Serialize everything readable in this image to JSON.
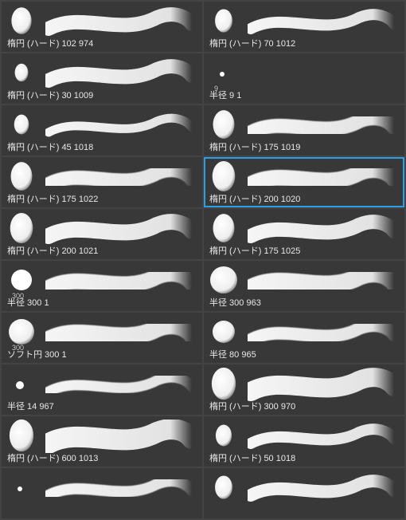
{
  "brushes": [
    {
      "label": "楕円 (ハード) 102 974",
      "tip": "ellipse-hard",
      "size": 30,
      "badge": "",
      "stroke": "s1",
      "selected": false
    },
    {
      "label": "楕円 (ハード) 70 1012",
      "tip": "ellipse-hard",
      "size": 26,
      "badge": "",
      "stroke": "s2",
      "selected": false
    },
    {
      "label": "楕円 (ハード) 30 1009",
      "tip": "ellipse-hard",
      "size": 20,
      "badge": "",
      "stroke": "s3",
      "selected": false
    },
    {
      "label": "半径  9 1",
      "tip": "radius-dot",
      "size": 6,
      "badge": "9",
      "stroke": "none",
      "selected": false
    },
    {
      "label": "楕円 (ハード) 45 1018",
      "tip": "ellipse-hard",
      "size": 22,
      "badge": "",
      "stroke": "s4",
      "selected": false
    },
    {
      "label": "楕円 (ハード) 175 1019",
      "tip": "ellipse-hard",
      "size": 32,
      "badge": "",
      "stroke": "s5",
      "selected": false
    },
    {
      "label": "楕円 (ハード) 175 1022",
      "tip": "ellipse-hard",
      "size": 32,
      "badge": "",
      "stroke": "s6",
      "selected": false
    },
    {
      "label": "楕円 (ハード) 200 1020",
      "tip": "ellipse-hard",
      "size": 34,
      "badge": "",
      "stroke": "s7",
      "selected": true
    },
    {
      "label": "楕円 (ハード) 200 1021",
      "tip": "ellipse-hard",
      "size": 34,
      "badge": "",
      "stroke": "s8",
      "selected": false
    },
    {
      "label": "楕円 (ハード) 175 1025",
      "tip": "ellipse-hard",
      "size": 32,
      "badge": "",
      "stroke": "s9",
      "selected": false
    },
    {
      "label": "半径  300 1",
      "tip": "radius-hard",
      "size": 26,
      "badge": "300",
      "stroke": "s10",
      "selected": false
    },
    {
      "label": "半径  300 963",
      "tip": "radius-soft",
      "size": 34,
      "badge": "",
      "stroke": "s11",
      "selected": false
    },
    {
      "label": "ソフト円  300 1",
      "tip": "soft-round",
      "size": 32,
      "badge": "300",
      "stroke": "s12",
      "selected": false
    },
    {
      "label": "半径  80 965",
      "tip": "radius-soft",
      "size": 28,
      "badge": "",
      "stroke": "s13",
      "selected": false
    },
    {
      "label": "半径  14 967",
      "tip": "radius-dot",
      "size": 10,
      "badge": "",
      "stroke": "s14",
      "selected": false
    },
    {
      "label": "楕円 (ハード) 300 970",
      "tip": "ellipse-hard",
      "size": 36,
      "badge": "",
      "stroke": "s15",
      "selected": false
    },
    {
      "label": "楕円 (ハード) 600 1013",
      "tip": "ellipse-hard",
      "size": 36,
      "badge": "",
      "stroke": "s16",
      "selected": false
    },
    {
      "label": "楕円 (ハード) 50 1018",
      "tip": "ellipse-hard",
      "size": 24,
      "badge": "",
      "stroke": "s17",
      "selected": false
    },
    {
      "label": "",
      "tip": "radius-dot",
      "size": 6,
      "badge": "",
      "stroke": "s18",
      "selected": false
    },
    {
      "label": "",
      "tip": "ellipse-hard",
      "size": 26,
      "badge": "",
      "stroke": "s19",
      "selected": false
    }
  ]
}
